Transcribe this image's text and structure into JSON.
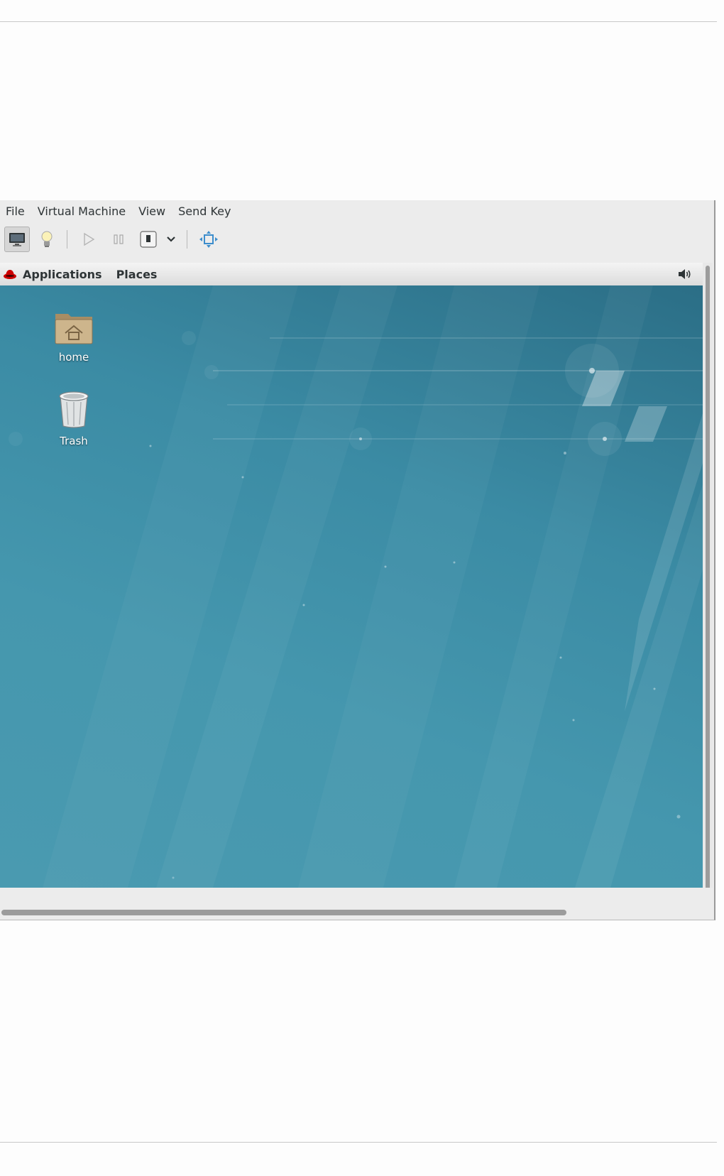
{
  "menubar": {
    "items": [
      "File",
      "Virtual Machine",
      "View",
      "Send Key"
    ]
  },
  "toolbar": {
    "buttons": [
      "display-console",
      "details-lightbulb",
      "run",
      "pause",
      "shutdown",
      "shutdown-menu",
      "fullscreen"
    ]
  },
  "guest_panel": {
    "applications_label": "Applications",
    "places_label": "Places",
    "volume_icon": "speaker-icon"
  },
  "desktop": {
    "icons": [
      {
        "label": "home",
        "icon": "home-folder-icon"
      },
      {
        "label": "Trash",
        "icon": "trash-icon"
      }
    ]
  },
  "colors": {
    "desktop_blue": "#3b8ba4",
    "panel": "#e6e6e6",
    "window_bg": "#ececec"
  }
}
